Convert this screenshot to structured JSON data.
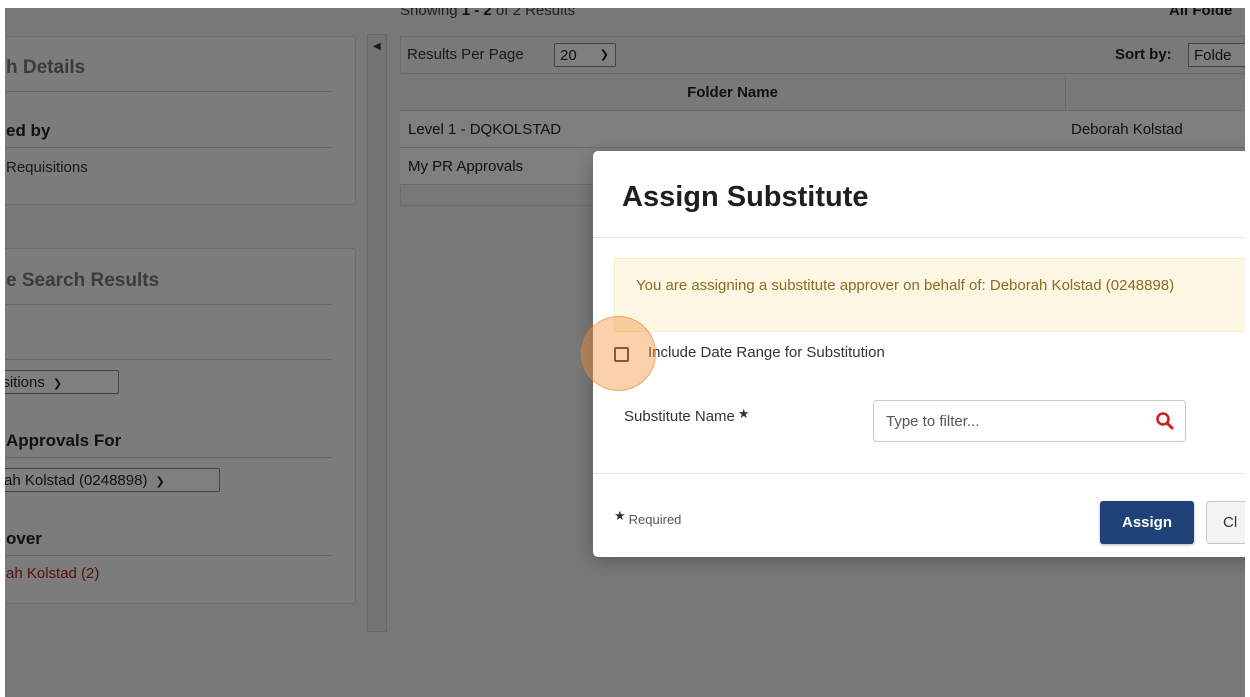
{
  "left_panel": {
    "search_details_title": "h Details",
    "assigned_by_label": "ed by",
    "assigned_by_value": "Requisitions",
    "refine_title": "e Search Results",
    "type_select": "isitions",
    "approvals_for_label": "Approvals For",
    "approvals_for_select": "rah Kolstad (0248898)",
    "approver_label": "over",
    "approver_value": "ah Kolstad (2)"
  },
  "results": {
    "showing_prefix": "Showing",
    "showing_range": "1 - 2",
    "showing_suffix": "of 2 Results",
    "all_folders": "All Folde",
    "rpp_label": "Results Per Page",
    "rpp_value": "20",
    "sort_label": "Sort by:",
    "sort_value": "Folde",
    "column_folder": "Folder Name",
    "rows": [
      {
        "folder": "Level 1 - DQKOLSTAD",
        "owner": "Deborah Kolstad"
      },
      {
        "folder": "My PR Approvals",
        "owner": ""
      }
    ]
  },
  "modal": {
    "title": "Assign Substitute",
    "alert": "You are assigning a substitute approver on behalf of: Deborah Kolstad (0248898)",
    "checkbox_label": "Include Date Range for Substitution",
    "checkbox_checked": false,
    "substitute_label": "Substitute Name",
    "required_star": "★",
    "substitute_placeholder": "Type to filter...",
    "required_note": "Required",
    "assign_button": "Assign",
    "close_button": "Cl"
  },
  "icons": {
    "collapse": "collapse-left-icon",
    "search": "search-icon",
    "chevron": "chevron-down-icon"
  },
  "colors": {
    "primary_button": "#1e4277",
    "alert_bg": "#fcf6e3",
    "alert_text": "#8c6d1f",
    "search_icon": "#cc1f1f",
    "click_highlight": "#f39236"
  }
}
